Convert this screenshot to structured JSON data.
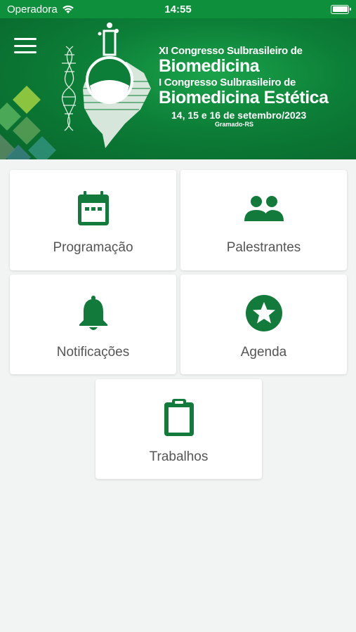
{
  "status_bar": {
    "carrier": "Operadora",
    "time": "14:55"
  },
  "banner": {
    "line1": "XI Congresso Sulbrasileiro de",
    "line2": "Biomedicina",
    "line3": "I Congresso Sulbrasileiro de",
    "line4": "Biomedicina Estética",
    "dates": "14, 15 e 16 de setembro/2023",
    "location": "Gramado-RS"
  },
  "menu": {
    "items": [
      {
        "label": "Programação",
        "icon": "calendar-icon"
      },
      {
        "label": "Palestrantes",
        "icon": "people-icon"
      },
      {
        "label": "Notificações",
        "icon": "bell-icon"
      },
      {
        "label": "Agenda",
        "icon": "star-icon"
      },
      {
        "label": "Trabalhos",
        "icon": "clipboard-icon"
      }
    ]
  },
  "colors": {
    "primary": "#0e8f3c",
    "icon": "#127a3a",
    "label": "#555555",
    "background": "#f2f4f3"
  }
}
